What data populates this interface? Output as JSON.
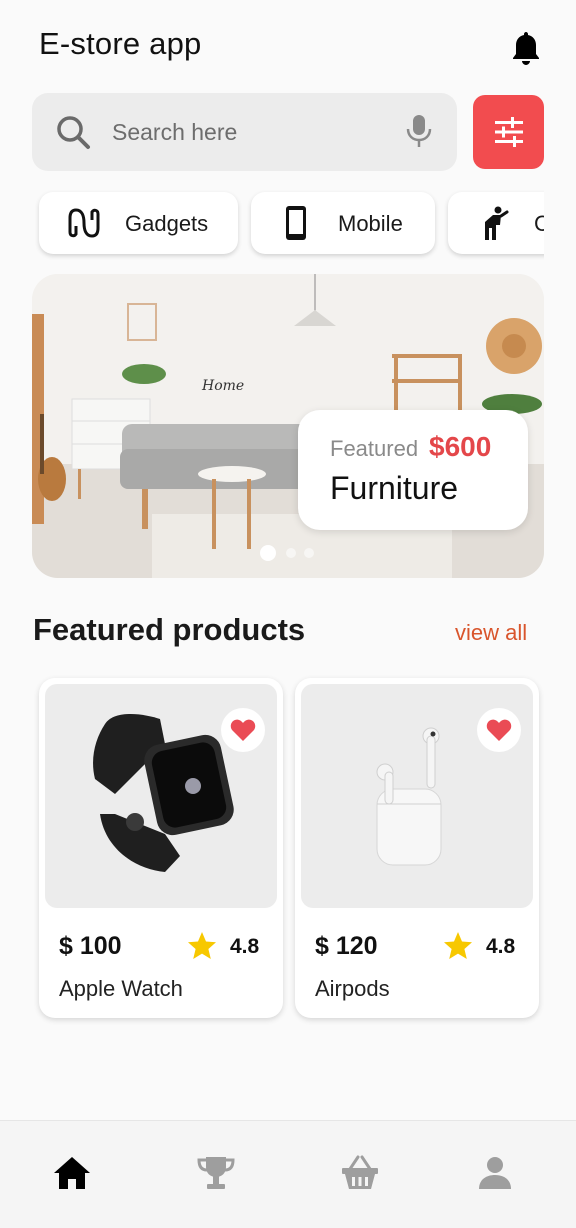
{
  "header": {
    "title": "E-store app",
    "notification_icon": "bell-icon"
  },
  "search": {
    "placeholder": "Search here",
    "value": "",
    "icons": [
      "search-icon",
      "microphone-icon"
    ],
    "filter_icon": "sliders-icon",
    "filter_color": "#f24c4f"
  },
  "categories": [
    {
      "label": "Gadgets",
      "icon": "earphones-icon"
    },
    {
      "label": "Mobile",
      "icon": "smartphone-icon"
    },
    {
      "label": "C",
      "icon": "person-icon"
    }
  ],
  "banner": {
    "tag": "Featured",
    "price": "$600",
    "title": "Furniture",
    "slides": 3,
    "active_slide": 1,
    "image": "living-room-furniture-photo"
  },
  "featured": {
    "title": "Featured products",
    "view_all": "view all",
    "products": [
      {
        "price": "$ 100",
        "rating": "4.8",
        "name": "Apple Watch",
        "image": "smartwatch-photo",
        "favorite": true
      },
      {
        "price": "$ 120",
        "rating": "4.8",
        "name": "Airpods",
        "image": "airpods-photo",
        "favorite": true
      }
    ]
  },
  "bottom_nav": {
    "items": [
      "home-icon",
      "trophy-icon",
      "basket-icon",
      "user-icon"
    ],
    "active": "home-icon"
  },
  "colors": {
    "accent": "#f24c4f",
    "price_red": "#e4474a",
    "link_orange": "#d9552c",
    "star_yellow": "#f7c800"
  }
}
